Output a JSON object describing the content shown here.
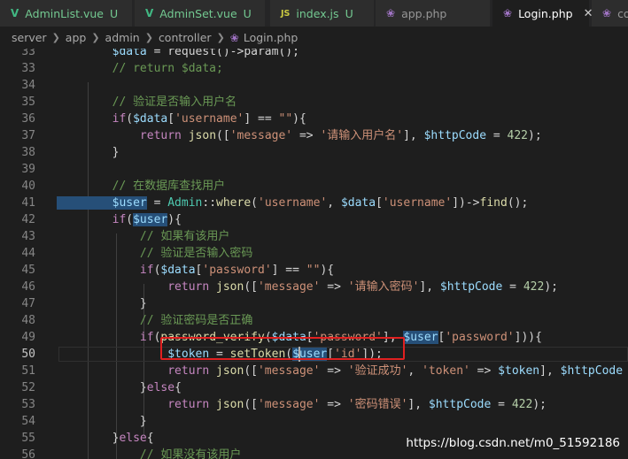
{
  "tabs": [
    {
      "icon": "vue",
      "name": "AdminList.vue",
      "badge": "U",
      "active": false
    },
    {
      "icon": "vue",
      "name": "AdminSet.vue",
      "badge": "U",
      "active": false
    },
    {
      "icon": "js",
      "name": "index.js",
      "badge": "U",
      "active": false
    },
    {
      "icon": "php",
      "name": "app.php",
      "badge": "",
      "active": false
    },
    {
      "icon": "php",
      "name": "Login.php",
      "badge": "",
      "active": true
    },
    {
      "icon": "php",
      "name": "co",
      "badge": "",
      "active": false
    }
  ],
  "breadcrumb": [
    "server",
    "app",
    "admin",
    "controller",
    "Login.php"
  ],
  "current_line": 50,
  "code_lines": [
    {
      "n": 33,
      "tokens": [
        [
          "t-var",
          "        $data"
        ],
        [
          "t-pun",
          " = request()->param();"
        ]
      ]
    },
    {
      "n": 33,
      "tokens": [
        [
          "t-cmt",
          "        // return $data;"
        ]
      ]
    },
    {
      "n": 34,
      "tokens": []
    },
    {
      "n": 35,
      "tokens": [
        [
          "t-cmt",
          "        // 验证是否输入用户名"
        ]
      ]
    },
    {
      "n": 36,
      "tokens": [
        [
          "t-ctl",
          "        if"
        ],
        [
          "t-pun",
          "("
        ],
        [
          "t-var",
          "$data"
        ],
        [
          "t-pun",
          "["
        ],
        [
          "t-str",
          "'username'"
        ],
        [
          "t-pun",
          "] == "
        ],
        [
          "t-str",
          "\"\""
        ],
        [
          "t-pun",
          "){"
        ]
      ]
    },
    {
      "n": 37,
      "tokens": [
        [
          "t-ctl",
          "            return "
        ],
        [
          "t-fn",
          "json"
        ],
        [
          "t-pun",
          "(["
        ],
        [
          "t-str",
          "'message'"
        ],
        [
          "t-pun",
          " => "
        ],
        [
          "t-str",
          "'请输入用户名'"
        ],
        [
          "t-pun",
          "], "
        ],
        [
          "t-var",
          "$httpCode"
        ],
        [
          "t-pun",
          " = "
        ],
        [
          "t-num",
          "422"
        ],
        [
          "t-pun",
          ");"
        ]
      ]
    },
    {
      "n": 38,
      "tokens": [
        [
          "t-pun",
          "        }"
        ]
      ]
    },
    {
      "n": 39,
      "tokens": []
    },
    {
      "n": 40,
      "tokens": [
        [
          "t-cmt",
          "        // 在数据库查找用户"
        ]
      ]
    },
    {
      "n": 41,
      "tokens": [
        [
          "t-var hl",
          "        $user"
        ],
        [
          "t-pun",
          " = "
        ],
        [
          "t-cls",
          "Admin"
        ],
        [
          "t-pun",
          "::"
        ],
        [
          "t-fn",
          "where"
        ],
        [
          "t-pun",
          "("
        ],
        [
          "t-str",
          "'username'"
        ],
        [
          "t-pun",
          ", "
        ],
        [
          "t-var",
          "$data"
        ],
        [
          "t-pun",
          "["
        ],
        [
          "t-str",
          "'username'"
        ],
        [
          "t-pun",
          "])->"
        ],
        [
          "t-fn",
          "find"
        ],
        [
          "t-pun",
          "();"
        ]
      ]
    },
    {
      "n": 42,
      "tokens": [
        [
          "t-ctl",
          "        if"
        ],
        [
          "t-pun",
          "("
        ],
        [
          "t-var hl",
          "$user"
        ],
        [
          "t-pun",
          "){"
        ]
      ]
    },
    {
      "n": 43,
      "tokens": [
        [
          "t-cmt",
          "            // 如果有该用户"
        ]
      ]
    },
    {
      "n": 44,
      "tokens": [
        [
          "t-cmt",
          "            // 验证是否输入密码"
        ]
      ]
    },
    {
      "n": 45,
      "tokens": [
        [
          "t-ctl",
          "            if"
        ],
        [
          "t-pun",
          "("
        ],
        [
          "t-var",
          "$data"
        ],
        [
          "t-pun",
          "["
        ],
        [
          "t-str",
          "'password'"
        ],
        [
          "t-pun",
          "] == "
        ],
        [
          "t-str",
          "\"\""
        ],
        [
          "t-pun",
          "){"
        ]
      ]
    },
    {
      "n": 46,
      "tokens": [
        [
          "t-ctl",
          "                return "
        ],
        [
          "t-fn",
          "json"
        ],
        [
          "t-pun",
          "(["
        ],
        [
          "t-str",
          "'message'"
        ],
        [
          "t-pun",
          " => "
        ],
        [
          "t-str",
          "'请输入密码'"
        ],
        [
          "t-pun",
          "], "
        ],
        [
          "t-var",
          "$httpCode"
        ],
        [
          "t-pun",
          " = "
        ],
        [
          "t-num",
          "422"
        ],
        [
          "t-pun",
          ");"
        ]
      ]
    },
    {
      "n": 47,
      "tokens": [
        [
          "t-pun",
          "            }"
        ]
      ]
    },
    {
      "n": 48,
      "tokens": [
        [
          "t-cmt",
          "            // 验证密码是否正确"
        ]
      ]
    },
    {
      "n": 49,
      "tokens": [
        [
          "t-ctl",
          "            if"
        ],
        [
          "t-pun",
          "("
        ],
        [
          "t-fn",
          "password_verify"
        ],
        [
          "t-pun",
          "("
        ],
        [
          "t-var",
          "$data"
        ],
        [
          "t-pun",
          "["
        ],
        [
          "t-str",
          "'password'"
        ],
        [
          "t-pun",
          "], "
        ],
        [
          "t-var hl",
          "$user"
        ],
        [
          "t-pun",
          "["
        ],
        [
          "t-str",
          "'password'"
        ],
        [
          "t-pun",
          "])){"
        ]
      ]
    },
    {
      "n": 50,
      "tokens": [
        [
          "t-var",
          "                $token"
        ],
        [
          "t-pun",
          " = "
        ],
        [
          "t-fn",
          "setToken"
        ],
        [
          "t-pun",
          "("
        ],
        [
          "t-var hl",
          "$user"
        ],
        [
          "t-pun",
          "["
        ],
        [
          "t-str",
          "'id'"
        ],
        [
          "t-pun",
          "]);"
        ]
      ]
    },
    {
      "n": 51,
      "tokens": [
        [
          "t-ctl",
          "                return "
        ],
        [
          "t-fn",
          "json"
        ],
        [
          "t-pun",
          "(["
        ],
        [
          "t-str",
          "'message'"
        ],
        [
          "t-pun",
          " => "
        ],
        [
          "t-str",
          "'验证成功'"
        ],
        [
          "t-pun",
          ", "
        ],
        [
          "t-str",
          "'token'"
        ],
        [
          "t-pun",
          " => "
        ],
        [
          "t-var",
          "$token"
        ],
        [
          "t-pun",
          "], "
        ],
        [
          "t-var",
          "$httpCode"
        ],
        [
          "t-pun",
          " ="
        ]
      ]
    },
    {
      "n": 52,
      "tokens": [
        [
          "t-pun",
          "            }"
        ],
        [
          "t-ctl",
          "else"
        ],
        [
          "t-pun",
          "{"
        ]
      ]
    },
    {
      "n": 53,
      "tokens": [
        [
          "t-ctl",
          "                return "
        ],
        [
          "t-fn",
          "json"
        ],
        [
          "t-pun",
          "(["
        ],
        [
          "t-str",
          "'message'"
        ],
        [
          "t-pun",
          " => "
        ],
        [
          "t-str",
          "'密码错误'"
        ],
        [
          "t-pun",
          "], "
        ],
        [
          "t-var",
          "$httpCode"
        ],
        [
          "t-pun",
          " = "
        ],
        [
          "t-num",
          "422"
        ],
        [
          "t-pun",
          ");"
        ]
      ]
    },
    {
      "n": 54,
      "tokens": [
        [
          "t-pun",
          "            }"
        ]
      ]
    },
    {
      "n": 55,
      "tokens": [
        [
          "t-pun",
          "        }"
        ],
        [
          "t-ctl",
          "else"
        ],
        [
          "t-pun",
          "{"
        ]
      ]
    },
    {
      "n": 56,
      "tokens": [
        [
          "t-cmt",
          "            // 如果没有该用户"
        ]
      ]
    }
  ],
  "watermark": "https://blog.csdn.net/m0_51592186"
}
